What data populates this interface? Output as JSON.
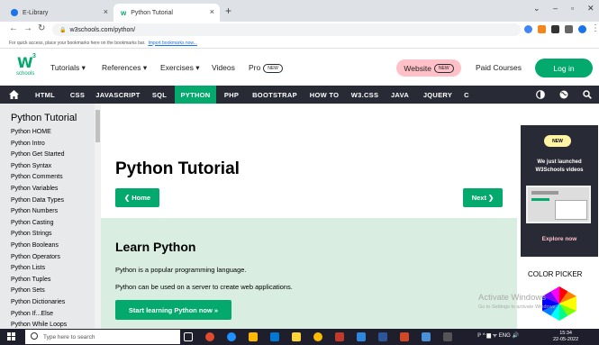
{
  "browser": {
    "tabs": [
      {
        "label": "E-Library",
        "close": "×"
      },
      {
        "label": "Python Tutorial",
        "close": "×"
      }
    ],
    "new_tab": "+",
    "window_controls": [
      "⌄",
      "–",
      "▫",
      "✕"
    ],
    "url": "w3schools.com/python/",
    "bookmarks_hint": "For quick access, place your bookmarks here on the bookmarks bar.",
    "bookmarks_link": "Import bookmarks now..."
  },
  "topnav": {
    "logo_letter": "W",
    "logo_sup": "3",
    "logo_sub": "schools",
    "items": [
      {
        "label": "Tutorials ▾"
      },
      {
        "label": "References ▾"
      },
      {
        "label": "Exercises ▾"
      },
      {
        "label": "Videos"
      }
    ],
    "pro_label": "Pro",
    "new_badge": "NEW",
    "website_label": "Website",
    "paid_courses": "Paid Courses",
    "login": "Log in"
  },
  "darknav": {
    "items": [
      "HTML",
      "CSS",
      "JAVASCRIPT",
      "SQL",
      "PYTHON",
      "PHP",
      "BOOTSTRAP",
      "HOW TO",
      "W3.CSS",
      "JAVA",
      "JQUERY",
      "C"
    ]
  },
  "sidebar": {
    "title": "Python Tutorial",
    "items": [
      "Python HOME",
      "Python Intro",
      "Python Get Started",
      "Python Syntax",
      "Python Comments",
      "Python Variables",
      "Python Data Types",
      "Python Numbers",
      "Python Casting",
      "Python Strings",
      "Python Booleans",
      "Python Operators",
      "Python Lists",
      "Python Tuples",
      "Python Sets",
      "Python Dictionaries",
      "Python If...Else",
      "Python While Loops"
    ]
  },
  "main": {
    "title": "Python Tutorial",
    "home_btn": "❮ Home",
    "next_btn": "Next ❯",
    "learn_title": "Learn Python",
    "p1": "Python is a popular programming language.",
    "p2": "Python can be used on a server to create web applications.",
    "start_btn": "Start learning Python now »"
  },
  "right": {
    "ad_new": "NEW",
    "ad_text": "We just launched W3Schools videos",
    "ad_explore": "Explore now",
    "colorpicker": "COLOR PICKER"
  },
  "windows": {
    "activate": "Activate Windows",
    "activate_sub": "Go to Settings to activate Windows.",
    "search_placeholder": "Type here to search",
    "time": "15:34",
    "date": "22-05-2022"
  },
  "colors": {
    "accent": "#04aa6d",
    "dark": "#282a35",
    "sidebar_bg": "#e7e9eb",
    "green_bg": "#d9eee1",
    "pink": "#ffc0c7"
  }
}
